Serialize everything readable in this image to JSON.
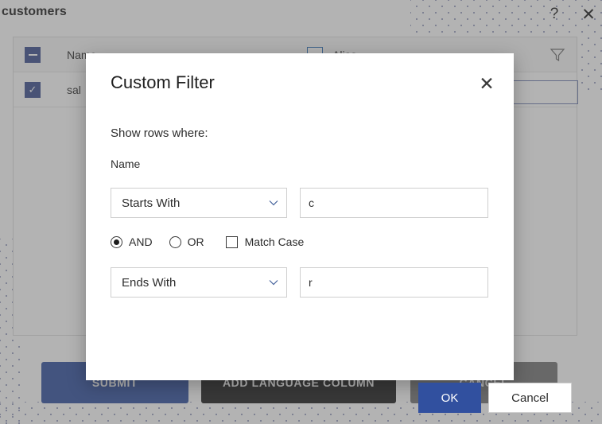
{
  "page": {
    "title": "customers",
    "help_icon": "?",
    "close_icon": "✕"
  },
  "grid": {
    "header": {
      "select_all_state": "indeterminate",
      "columns": [
        "Name",
        "Alias"
      ],
      "filter_icon": "filter-funnel-icon"
    },
    "rows": [
      {
        "selected": true,
        "name": "sal",
        "alias": ""
      }
    ],
    "alias_input_value": "",
    "alias_input_placeholder": ""
  },
  "actions": {
    "submit": "SUBMIT",
    "add_language_column": "ADD LANGUAGE COLUMN",
    "cancel": "CANCEL"
  },
  "dialog": {
    "title": "Custom Filter",
    "close_icon": "✕",
    "subtitle": "Show rows where:",
    "field_label": "Name",
    "condition_1": {
      "operator": "Starts With",
      "value": "c",
      "placeholder": ""
    },
    "condition_2": {
      "operator": "Ends With",
      "value": "r",
      "placeholder": ""
    },
    "logic": {
      "and_label": "AND",
      "or_label": "OR",
      "selected": "AND",
      "match_case_label": "Match Case",
      "match_case_checked": false
    },
    "buttons": {
      "ok": "OK",
      "cancel": "Cancel"
    }
  },
  "colors": {
    "accent_blue": "#31509f",
    "checkbox_blue": "#3b4f8f",
    "dark_button": "#1c1c1c",
    "gray_button": "#757575",
    "dot_pattern": "#8d93b8"
  }
}
